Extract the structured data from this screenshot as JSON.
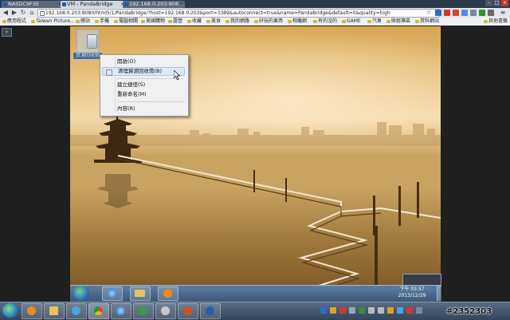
{
  "browser": {
    "tabs": [
      {
        "label": "NASDC9F3E"
      },
      {
        "label": "VM - PandaBridge"
      },
      {
        "label": "192.168.0.203:808..."
      }
    ],
    "address": "192.168.0.203:8080/html5/1/PandaBridge/?host=192.168.0.203&port=3389&autoconnect=true&name=PandaBridge&default=0&quality=high",
    "bookmarks": [
      "應用程式",
      "Taiwan Picture...",
      "總站",
      "手機",
      "電腦相關",
      "美國購物",
      "露營",
      "收藏",
      "美食",
      "我的網路",
      "好玩的東西",
      "相機網",
      "有的沒的",
      "GAME",
      "汽車",
      "財經專區",
      "資料網站"
    ],
    "other_bookmarks": "其他書籤"
  },
  "remote": {
    "desktop_icon_label": "資源回收筒",
    "context_menu": {
      "items": [
        "開啟(O)",
        "清理資源回收筒(B)",
        "建立捷徑(S)",
        "重新命名(M)",
        "內容(R)"
      ],
      "highlighted_index": 1
    },
    "clock": {
      "time": "下午 03:57",
      "date": "2013/12/29"
    }
  },
  "watermark": "#2352303"
}
